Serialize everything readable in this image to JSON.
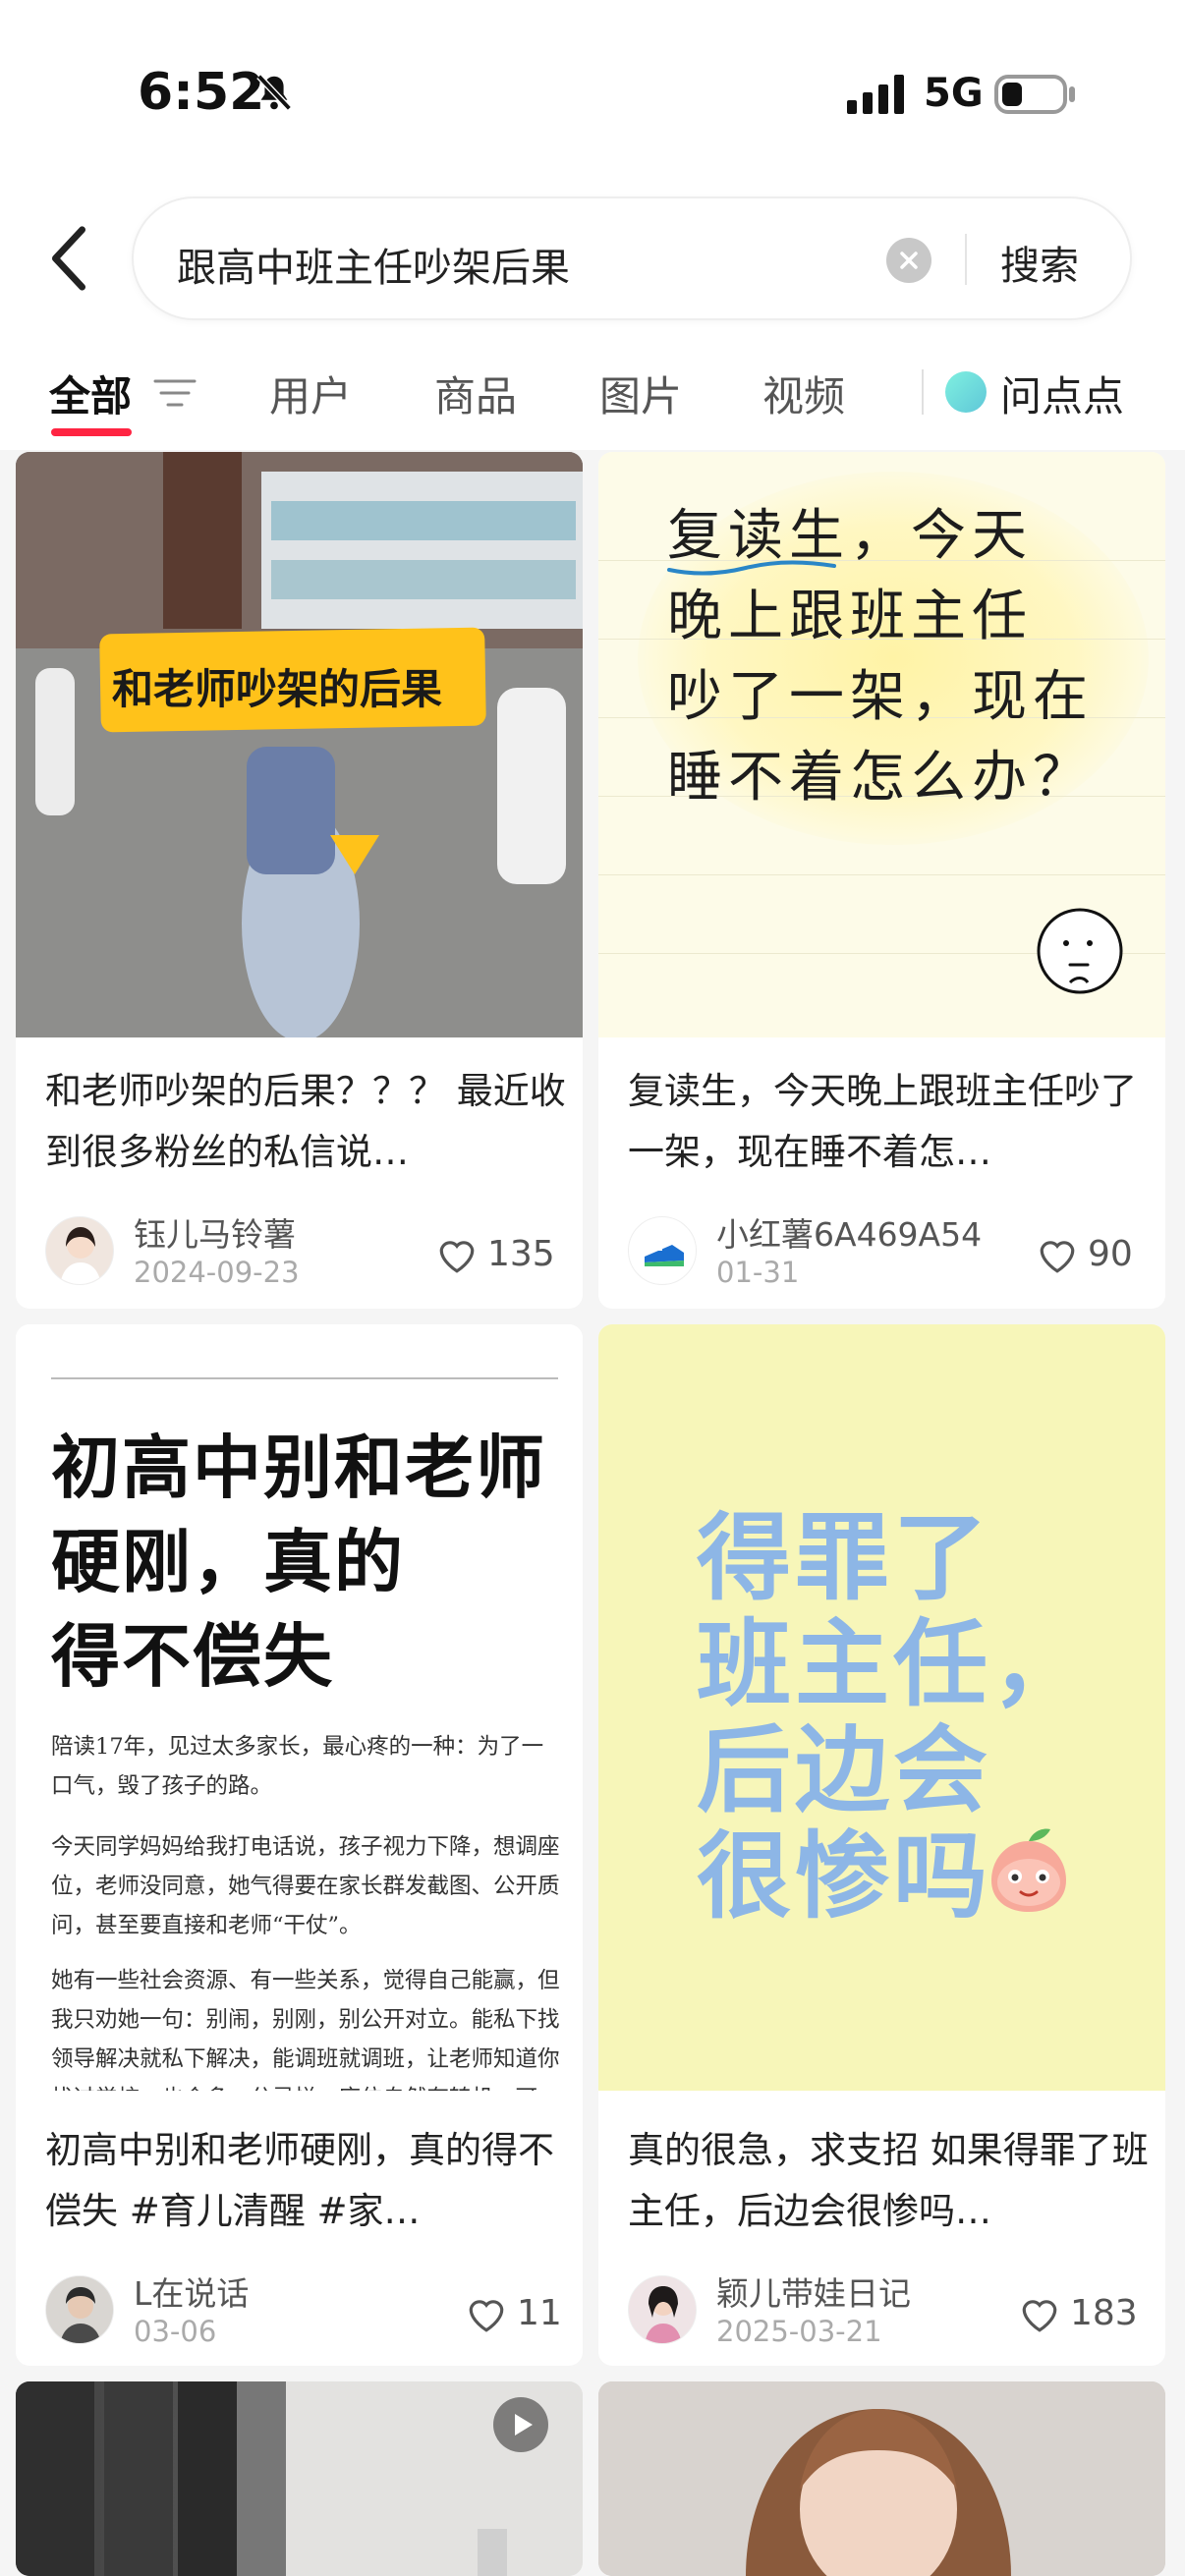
{
  "status": {
    "time": "6:52",
    "network": "5G"
  },
  "search": {
    "query": "跟高中班主任吵架后果",
    "button": "搜索"
  },
  "tabs": [
    {
      "label": "全部"
    },
    {
      "label": "用户"
    },
    {
      "label": "商品"
    },
    {
      "label": "图片"
    },
    {
      "label": "视频"
    }
  ],
  "ai_entry": {
    "label": "问点点"
  },
  "cards": [
    {
      "cover_text": "和老师吵架的后果",
      "title": "和老师吵架的后果？？？  最近收到很多粉丝的私信说…",
      "author": "钰儿马铃薯",
      "date": "2024-09-23",
      "likes": "135"
    },
    {
      "cover_lines": [
        "复读生，今天",
        "晚上跟班主任",
        "吵了一架，现在",
        "睡不着怎么办？"
      ],
      "title": "复读生，今天晚上跟班主任吵了一架，现在睡不着怎…",
      "author": "小红薯6A469A54",
      "date": "01-31",
      "likes": "90"
    },
    {
      "cover_lines": [
        "初高中别和老师",
        "硬刚，真的",
        "得不偿失"
      ],
      "cover_paragraphs": [
        "陪读17年，见过太多家长，最心疼的一种：为了一口气，毁了孩子的路。",
        "今天同学妈妈给我打电话说，孩子视力下降，想调座位，老师没同意，她气得要在家长群发截图、公开质问，甚至要直接和老师“干仗”。",
        "她有一些社会资源、有一些关系，觉得自己能赢，但我只劝她一句：别闹，别刚，别公开对立。能私下找领导解决就私下解决，能调班就调班，让老师知道你找过学校，也会多一分忌惮，座位自然有转机，可"
      ],
      "title": "初高中别和老师硬刚，真的得不偿失 #育儿清醒  #家…",
      "author": "L在说话",
      "date": "03-06",
      "likes": "11"
    },
    {
      "cover_lines": [
        "得罪了",
        "班主任，",
        "后边会",
        "很惨吗"
      ],
      "title": "真的很急，求支招 如果得罪了班主任，后边会很惨吗…",
      "author": "颖儿带娃日记",
      "date": "2025-03-21",
      "likes": "183"
    }
  ],
  "colors": {
    "accent": "#ff2442",
    "card4_text": "#8db6e6",
    "card4_bg": "#f7f6b9"
  }
}
